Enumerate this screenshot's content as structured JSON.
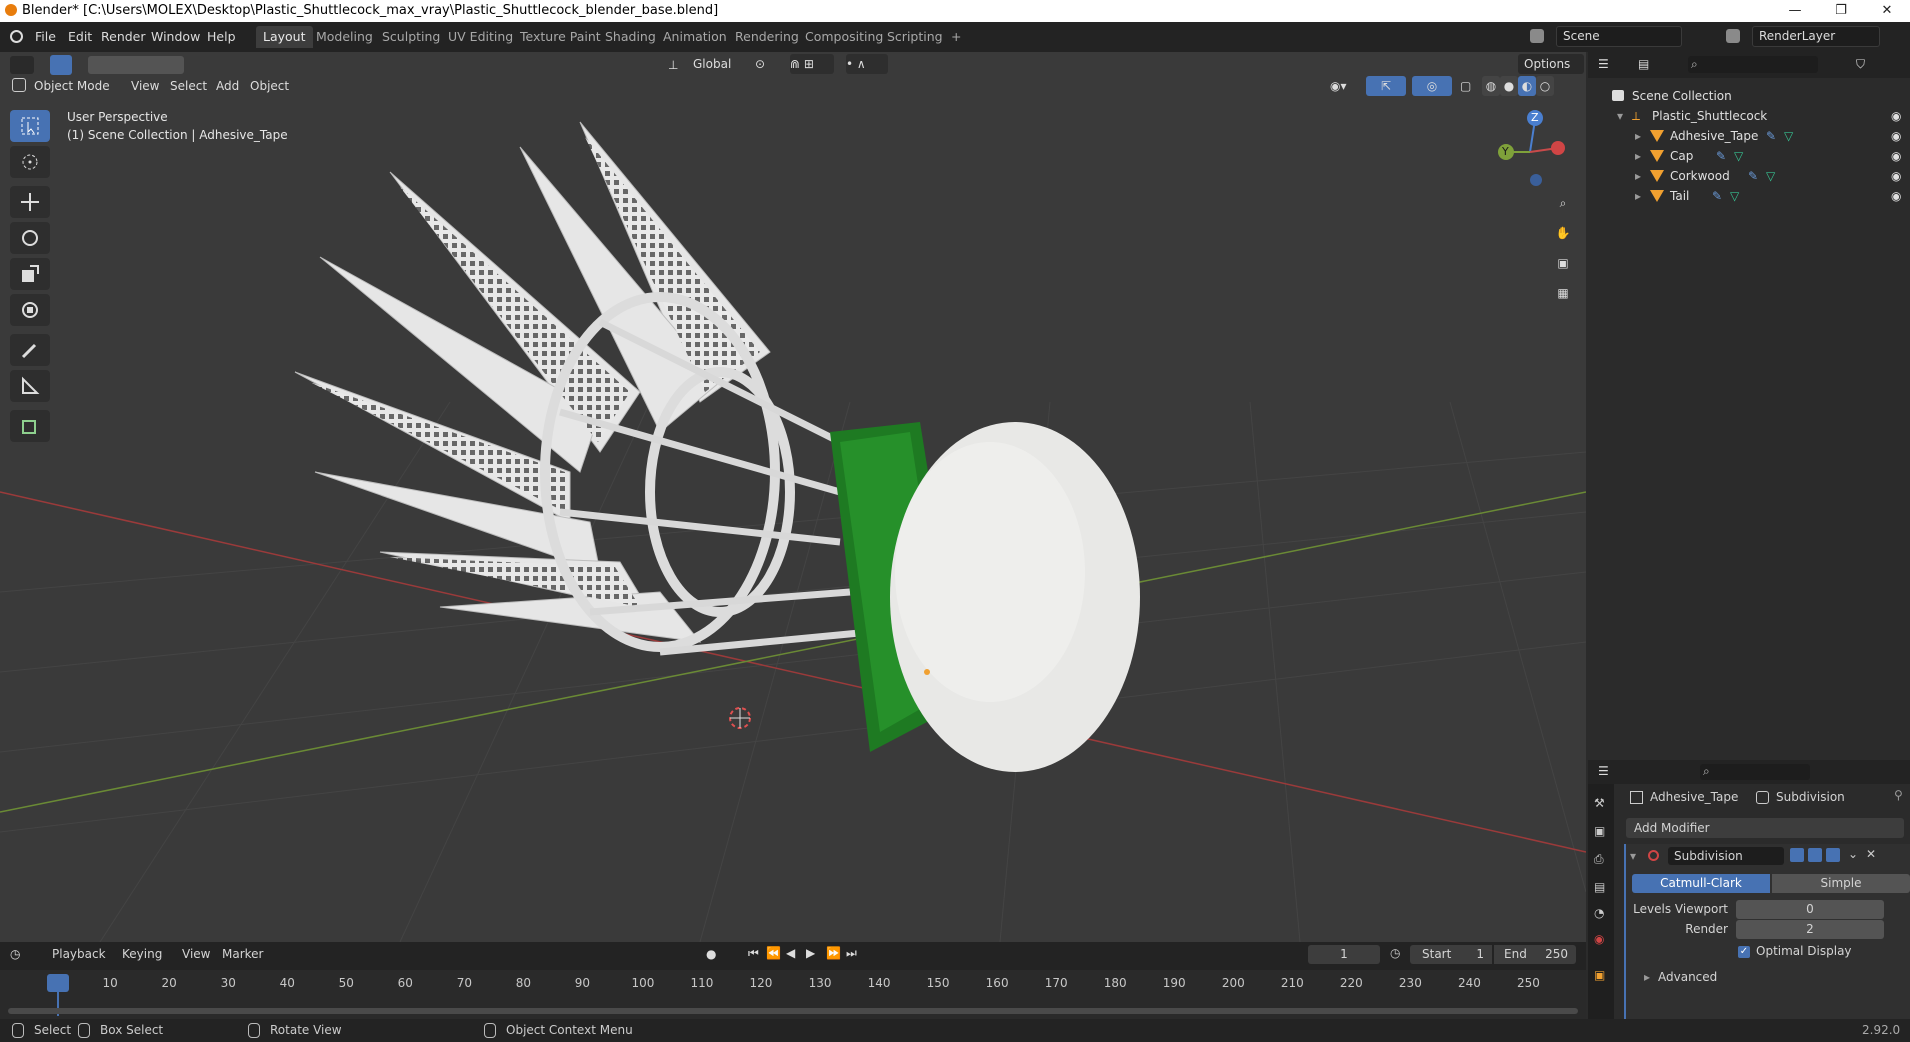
{
  "window": {
    "title": "Blender* [C:\\Users\\MOLEX\\Desktop\\Plastic_Shuttlecock_max_vray\\Plastic_Shuttlecock_blender_base.blend]",
    "minimize": "—",
    "restore": "❐",
    "close": "✕"
  },
  "menu": {
    "file": "File",
    "edit": "Edit",
    "render": "Render",
    "window": "Window",
    "help": "Help"
  },
  "workspaces": [
    "Layout",
    "Modeling",
    "Sculpting",
    "UV Editing",
    "Texture Paint",
    "Shading",
    "Animation",
    "Rendering",
    "Compositing",
    "Scripting",
    "+"
  ],
  "scene": {
    "name": "Scene",
    "render_layer": "RenderLayer"
  },
  "viewport": {
    "mode": "Object Mode",
    "menus": [
      "View",
      "Select",
      "Add",
      "Object"
    ],
    "transform_orientation": "Global",
    "options": "Options",
    "info_line1": "User Perspective",
    "info_line2": "(1) Scene Collection | Adhesive_Tape",
    "gizmo": {
      "z": "Z",
      "y": "Y"
    }
  },
  "outliner": {
    "root": "Scene Collection",
    "collection": "Plastic_Shuttlecock",
    "objects": [
      "Adhesive_Tape",
      "Cap",
      "Corkwood",
      "Tail"
    ]
  },
  "properties": {
    "object": "Adhesive_Tape",
    "modifier_crumb": "Subdivision",
    "add_modifier": "Add Modifier",
    "modifier_name": "Subdivision",
    "type_catmull": "Catmull-Clark",
    "type_simple": "Simple",
    "levels_label": "Levels Viewport",
    "levels_value": "0",
    "render_label": "Render",
    "render_value": "2",
    "optimal_display": "Optimal Display",
    "advanced": "Advanced"
  },
  "timeline": {
    "menus": [
      "Playback",
      "Keying",
      "View",
      "Marker"
    ],
    "current_frame": "1",
    "start_label": "Start",
    "start": "1",
    "end_label": "End",
    "end": "250",
    "ticks": [
      "1",
      "10",
      "20",
      "30",
      "40",
      "50",
      "60",
      "70",
      "80",
      "90",
      "100",
      "110",
      "120",
      "130",
      "140",
      "150",
      "160",
      "170",
      "180",
      "190",
      "200",
      "210",
      "220",
      "230",
      "240",
      "250"
    ]
  },
  "status": {
    "select": "Select",
    "box_select": "Box Select",
    "rotate_view": "Rotate View",
    "context_menu": "Object Context Menu",
    "version": "2.92.0"
  },
  "colors": {
    "accent": "#4772b3",
    "active_orange": "#f0a030",
    "grid_x": "#9b3a3a",
    "grid_y": "#6a8a35"
  }
}
